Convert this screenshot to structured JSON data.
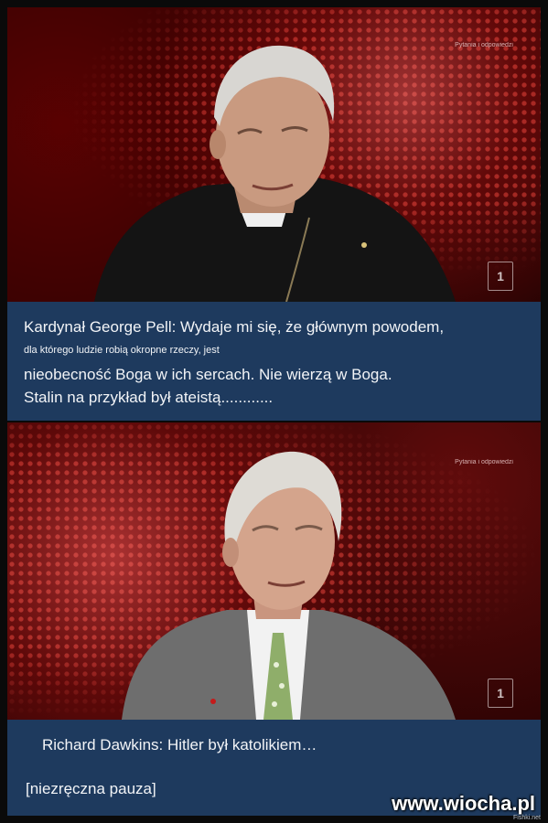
{
  "panel1": {
    "watermark": "Pytania i odpowiedzi",
    "channel_logo": "1",
    "caption": {
      "line1": "Kardynał George Pell: Wydaje mi się, że głównym powodem,",
      "line2": "dla którego ludzie robią okropne rzeczy, jest",
      "line3": "nieobecność Boga w ich sercach. Nie wierzą w Boga.",
      "line4": "Stalin na przykład był ateistą............"
    }
  },
  "panel2": {
    "watermark": "Pytania i odpowiedzi",
    "channel_logo": "1",
    "caption": {
      "line1": "Richard Dawkins: Hitler był katolikiem…",
      "line2": "[niezręczna pauza]"
    }
  },
  "site_watermark": "www.wiocha.pl",
  "source_watermark": "Fishki.net",
  "colors": {
    "caption_bg": "#1e3a5e",
    "studio_red": "#c41a1a"
  }
}
